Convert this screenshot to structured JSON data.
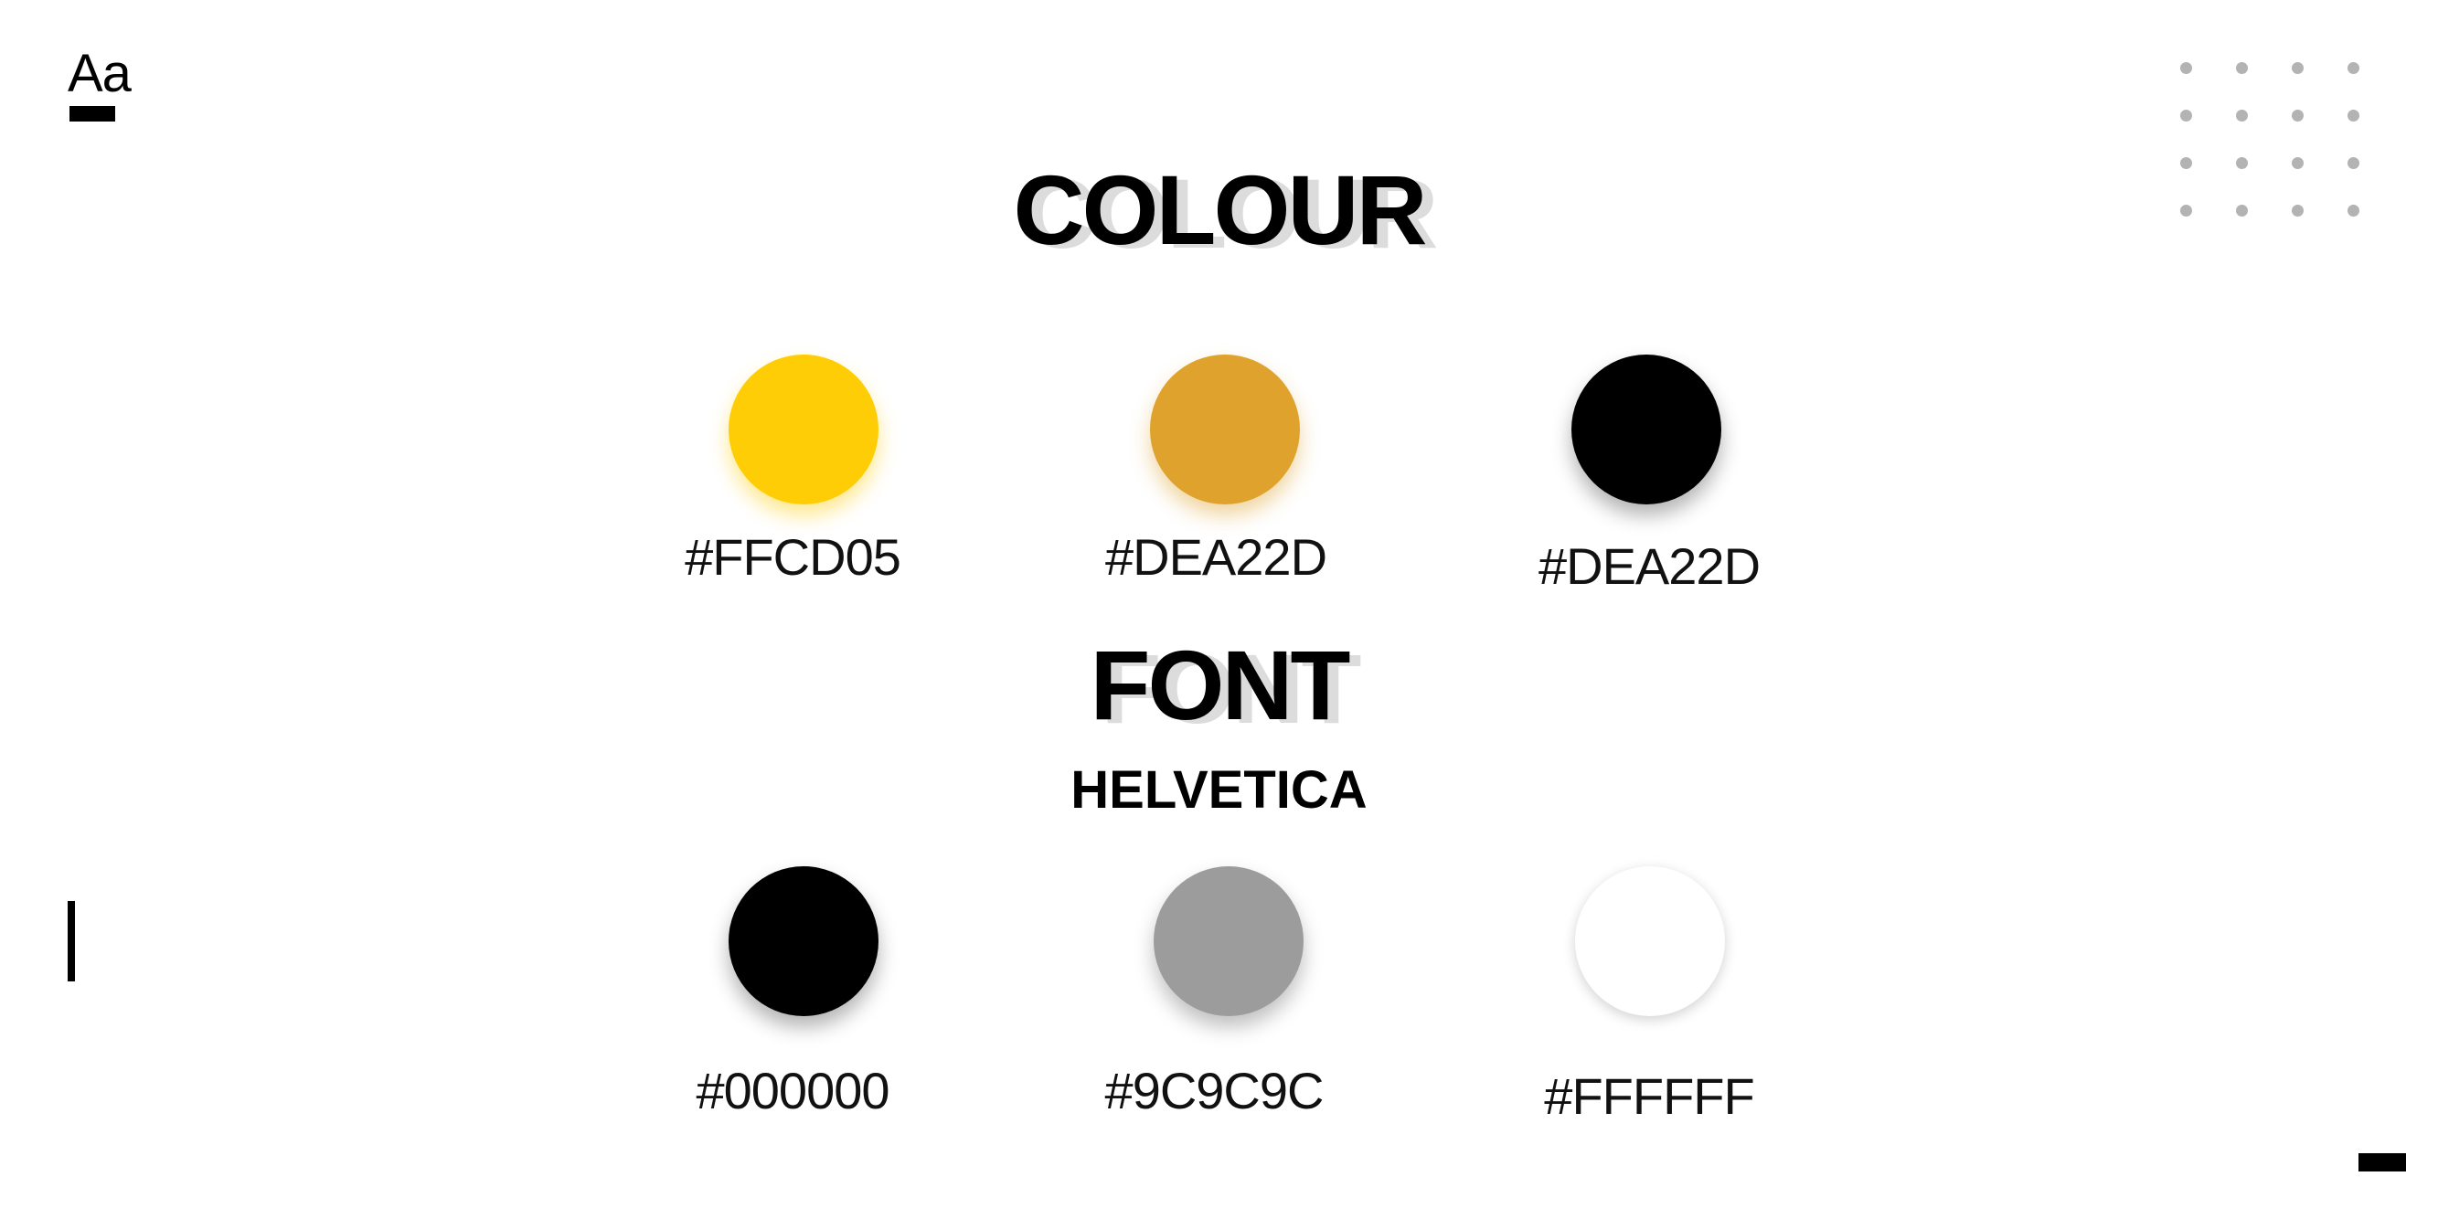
{
  "logo": {
    "text": "Aa"
  },
  "headings": {
    "colour": "COLOUR",
    "font": "FONT"
  },
  "font_name": "HELVETICA",
  "colour_swatches": [
    {
      "label": "#FFCD05",
      "color": "#FFCD05"
    },
    {
      "label": "#DEA22D",
      "color": "#DEA22D"
    },
    {
      "label": "#DEA22D",
      "color": "#000000"
    }
  ],
  "font_swatches": [
    {
      "label": "#000000",
      "color": "#000000"
    },
    {
      "label": "#9C9C9C",
      "color": "#9C9C9C"
    },
    {
      "label": "#FFFFFF",
      "color": "#FFFFFF"
    }
  ],
  "decor": {
    "dot_color": "#B3B3B3",
    "accent": "#000000"
  }
}
